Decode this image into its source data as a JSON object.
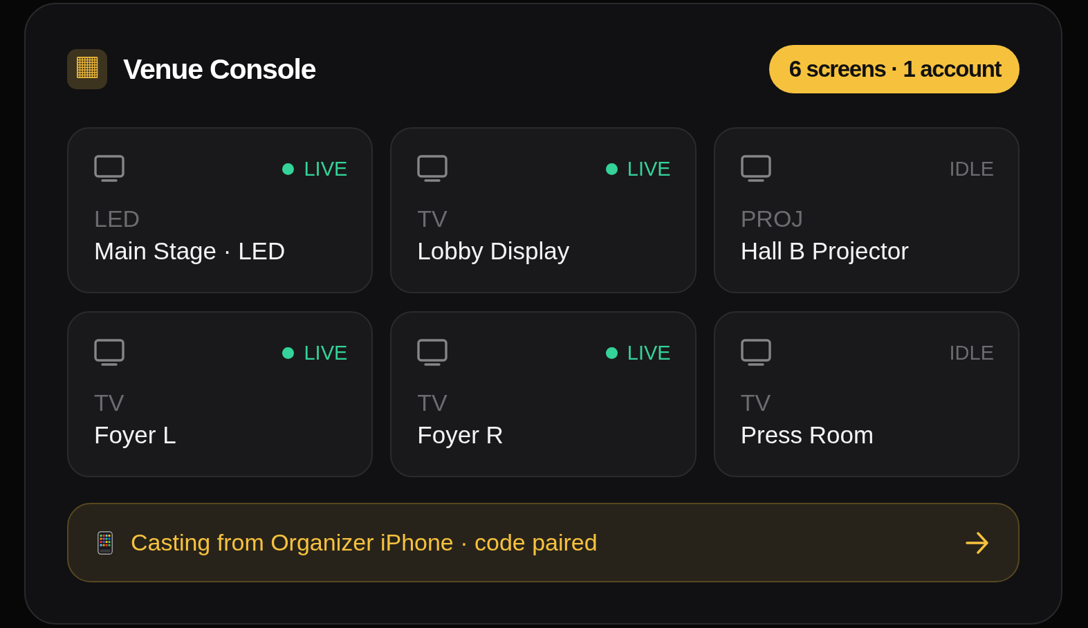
{
  "header": {
    "title": "Venue Console",
    "badge": "6 screens · 1 account"
  },
  "screens": [
    {
      "label": "LED",
      "name": "Main Stage · LED",
      "status": "LIVE",
      "live": true
    },
    {
      "label": "TV",
      "name": "Lobby Display",
      "status": "LIVE",
      "live": true
    },
    {
      "label": "PROJ",
      "name": "Hall B Projector",
      "status": "IDLE",
      "live": false
    },
    {
      "label": "TV",
      "name": "Foyer L",
      "status": "LIVE",
      "live": true
    },
    {
      "label": "TV",
      "name": "Foyer R",
      "status": "LIVE",
      "live": true
    },
    {
      "label": "TV",
      "name": "Press Room",
      "status": "IDLE",
      "live": false
    }
  ],
  "cast_banner": {
    "text": "Casting from Organizer iPhone · code paired"
  }
}
